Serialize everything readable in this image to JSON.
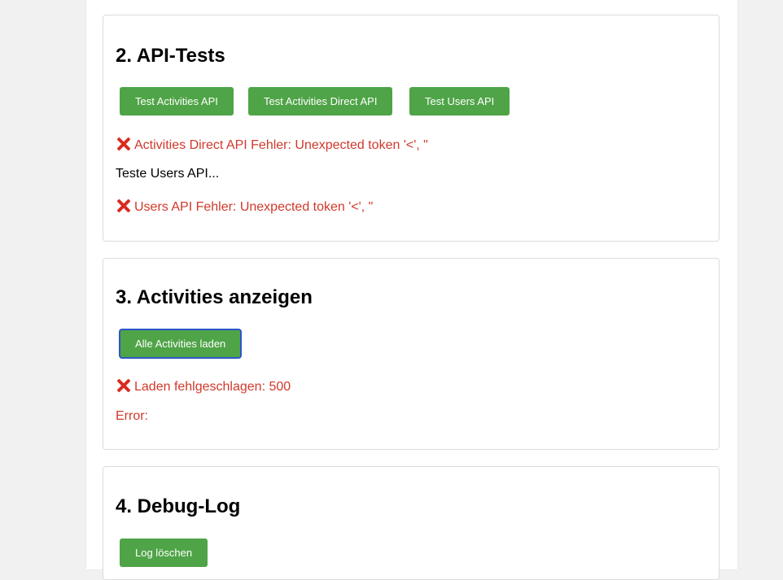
{
  "api_tests": {
    "heading": "2. API-Tests",
    "buttons": {
      "activities": "Test Activities API",
      "activities_direct": "Test Activities Direct API",
      "users": "Test Users API"
    },
    "messages": {
      "direct_error": "Activities Direct API Fehler: Unexpected token '<', \"",
      "users_testing": "Teste Users API...",
      "users_error": "Users API Fehler: Unexpected token '<', \""
    }
  },
  "activities": {
    "heading": "3. Activities anzeigen",
    "load_button": "Alle Activities laden",
    "messages": {
      "load_error": "Laden fehlgeschlagen: 500",
      "error_label": "Error:"
    }
  },
  "debug": {
    "heading": "4. Debug-Log",
    "clear_button": "Log löschen"
  },
  "icons": {
    "error": "cross-mark-icon"
  },
  "colors": {
    "button": "#4fa447",
    "error_text": "#d0392b",
    "focus_ring": "#2b56c9"
  }
}
